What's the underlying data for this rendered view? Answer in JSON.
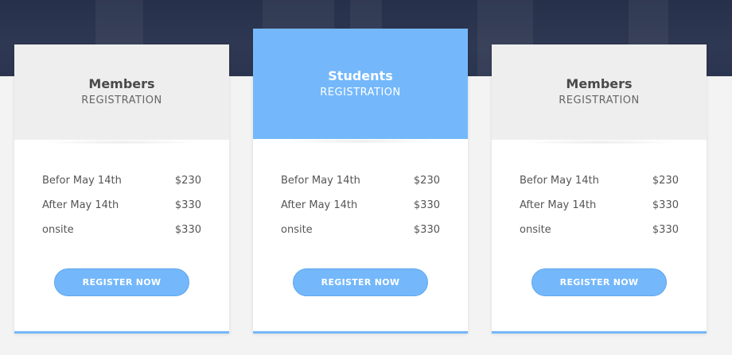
{
  "colors": {
    "accent": "#74b8fb",
    "hero_bg": "#2c3550",
    "card_head_bg": "#eeeeee",
    "page_bg": "#f3f3f3"
  },
  "cards": [
    {
      "title": "Members",
      "subtitle": "REGISTRATION",
      "prices": [
        {
          "label": "Befor May 14th",
          "price": "$230"
        },
        {
          "label": "After May 14th",
          "price": "$330"
        },
        {
          "label": "onsite",
          "price": "$330"
        }
      ],
      "button_label": "REGISTER NOW"
    },
    {
      "title": "Students",
      "subtitle": "REGISTRATION",
      "prices": [
        {
          "label": "Befor May 14th",
          "price": "$230"
        },
        {
          "label": "After May 14th",
          "price": "$330"
        },
        {
          "label": "onsite",
          "price": "$330"
        }
      ],
      "button_label": "REGISTER NOW"
    },
    {
      "title": "Members",
      "subtitle": "REGISTRATION",
      "prices": [
        {
          "label": "Befor May 14th",
          "price": "$230"
        },
        {
          "label": "After May 14th",
          "price": "$330"
        },
        {
          "label": "onsite",
          "price": "$330"
        }
      ],
      "button_label": "REGISTER NOW"
    }
  ]
}
